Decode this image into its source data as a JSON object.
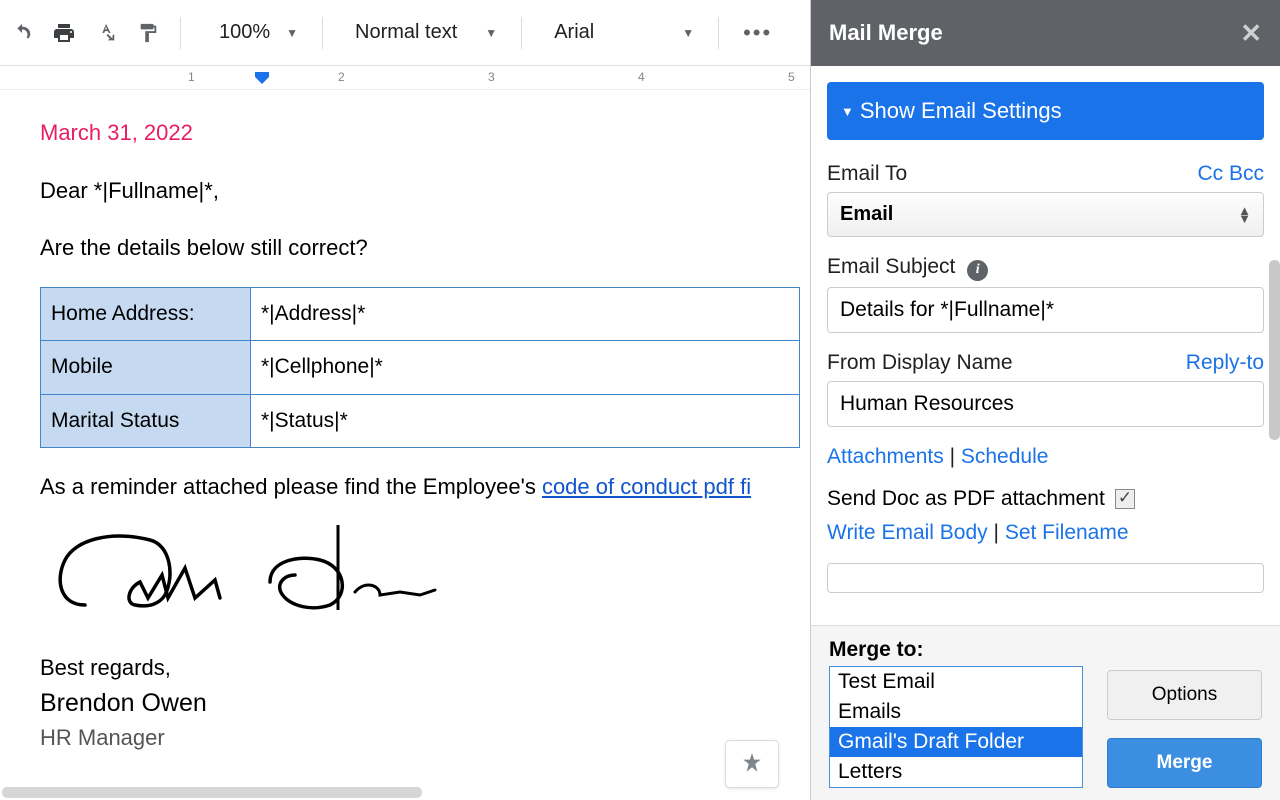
{
  "toolbar": {
    "zoom": "100%",
    "style": "Normal text",
    "font": "Arial"
  },
  "ruler": {
    "marks": [
      "1",
      "2",
      "3",
      "4",
      "5"
    ]
  },
  "document": {
    "date": "March 31, 2022",
    "greeting": "Dear *|Fullname|*,",
    "question": "Are the details below still correct?",
    "table": [
      {
        "label": "Home Address:",
        "value": "*|Address|*"
      },
      {
        "label": "Mobile",
        "value": "*|Cellphone|*"
      },
      {
        "label": "Marital Status",
        "value": "*|Status|*"
      }
    ],
    "reminder_prefix": "As a reminder attached please find the Employee's ",
    "reminder_link": "code of conduct pdf fi",
    "closing": "Best regards,",
    "signer_name": "Brendon Owen",
    "signer_title": "HR Manager"
  },
  "sidebar": {
    "title": "Mail Merge",
    "show_settings": "Show Email Settings",
    "email_to_label": "Email To",
    "cc": "Cc",
    "bcc": "Bcc",
    "email_to_value": "Email",
    "subject_label": "Email Subject",
    "subject_value": "Details for *|Fullname|*",
    "from_label": "From Display Name",
    "reply_to": "Reply-to",
    "from_value": "Human Resources",
    "attachments": "Attachments",
    "schedule": "Schedule",
    "pdf_label": "Send Doc as PDF attachment",
    "write_body": "Write Email Body",
    "set_filename": "Set Filename",
    "merge_to_label": "Merge to:",
    "merge_options": [
      "Test Email",
      "Emails",
      "Gmail's Draft Folder",
      "Letters"
    ],
    "merge_selected": "Gmail's Draft Folder",
    "options_btn": "Options",
    "merge_btn": "Merge"
  }
}
